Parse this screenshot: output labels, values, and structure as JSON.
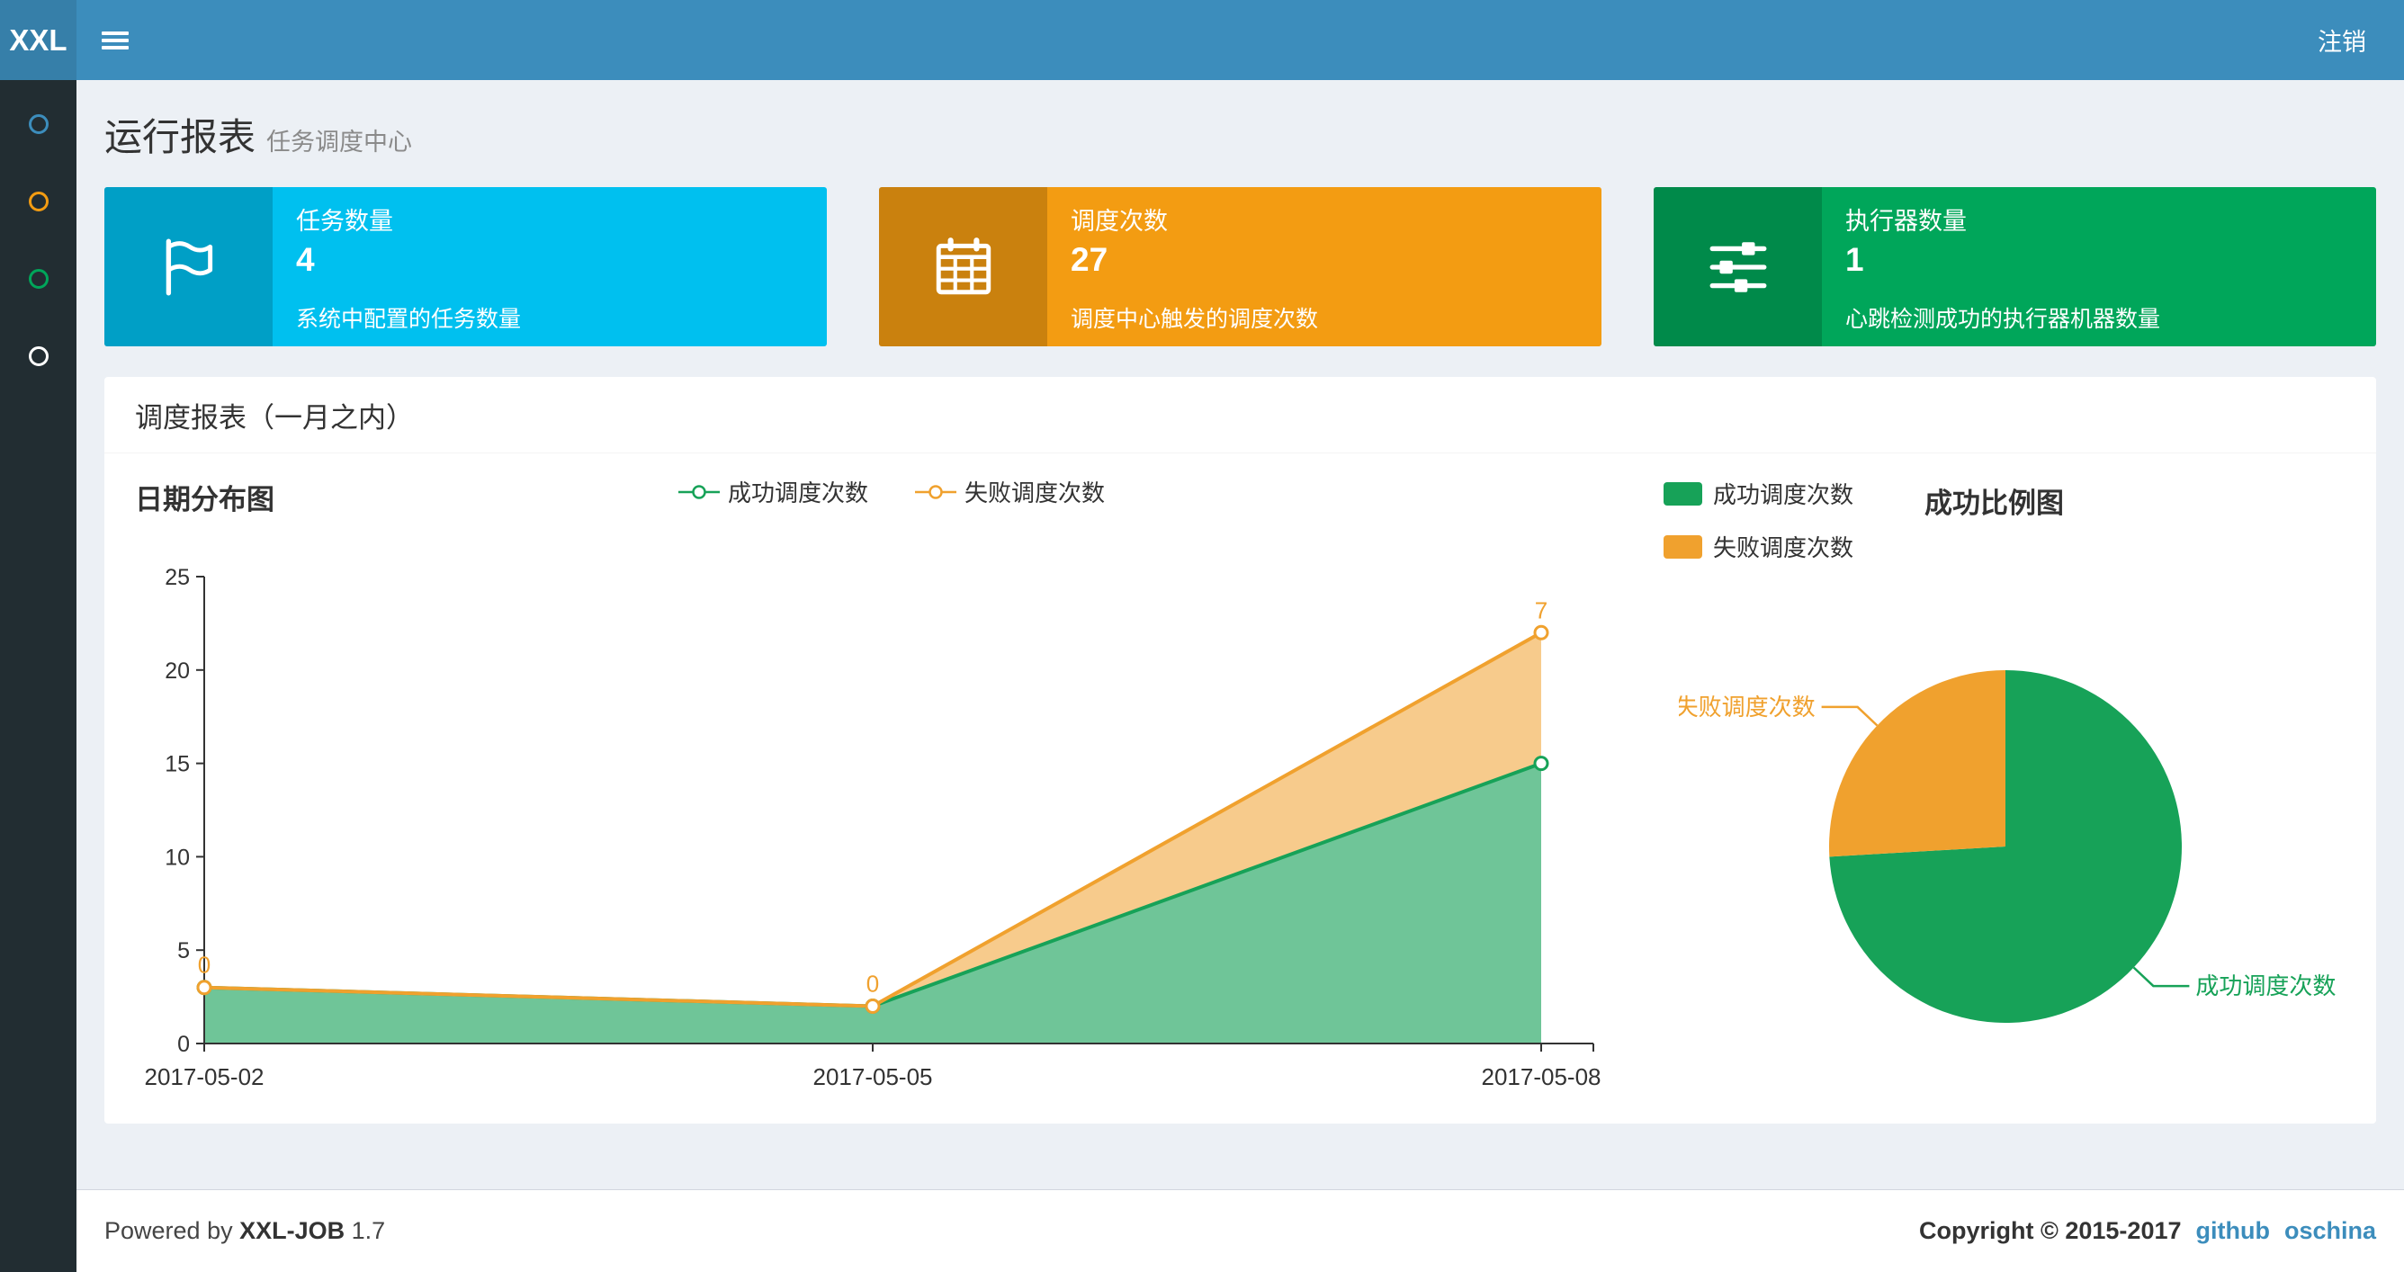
{
  "navbar": {
    "logo_text": "XXL",
    "logout_label": "注销"
  },
  "sidebar": {
    "items": [
      {
        "name": "nav-dashboard",
        "color": "#3c8dbc"
      },
      {
        "name": "nav-job-manage",
        "color": "#f39c12"
      },
      {
        "name": "nav-job-log",
        "color": "#00a65a"
      },
      {
        "name": "nav-help",
        "color": "#ffffff"
      }
    ]
  },
  "page_header": {
    "title": "运行报表",
    "subtitle": "任务调度中心"
  },
  "info_boxes": [
    {
      "label": "任务数量",
      "value": "4",
      "desc": "系统中配置的任务数量",
      "bg": "#00c0ef",
      "icon": "flag-icon"
    },
    {
      "label": "调度次数",
      "value": "27",
      "desc": "调度中心触发的调度次数",
      "bg": "#f39c12",
      "icon": "calendar-icon"
    },
    {
      "label": "执行器数量",
      "value": "1",
      "desc": "心跳检测成功的执行器机器数量",
      "bg": "#00a65a",
      "icon": "sliders-icon"
    }
  ],
  "panel": {
    "title": "调度报表（一月之内）"
  },
  "chart_data": [
    {
      "type": "area",
      "title": "日期分布图",
      "x": [
        "2017-05-02",
        "2017-05-05",
        "2017-05-08"
      ],
      "series": [
        {
          "name": "成功调度次数",
          "values": [
            3,
            2,
            15
          ],
          "color": "#17a258",
          "labels": [
            "",
            "",
            ""
          ]
        },
        {
          "name": "失败调度次数",
          "values": [
            0,
            0,
            7
          ],
          "color": "#f0a12e",
          "labels": [
            "0",
            "0",
            "7"
          ]
        }
      ],
      "stacked": true,
      "ylim": [
        0,
        25
      ],
      "yticks": [
        0,
        5,
        10,
        15,
        20,
        25
      ],
      "legend_position": "top-center",
      "grid": false
    },
    {
      "type": "pie",
      "title": "成功比例图",
      "slices": [
        {
          "name": "成功调度次数",
          "value": 20,
          "color": "#17a258"
        },
        {
          "name": "失败调度次数",
          "value": 7,
          "color": "#f0a12e"
        }
      ],
      "legend_position": "top-left"
    }
  ],
  "footer": {
    "powered_prefix": "Powered by",
    "product": "XXL-JOB",
    "version": "1.7",
    "copyright": "Copyright © 2015-2017",
    "links": [
      {
        "label": "github"
      },
      {
        "label": "oschina"
      }
    ],
    "link_color": "#3c8dbc"
  }
}
